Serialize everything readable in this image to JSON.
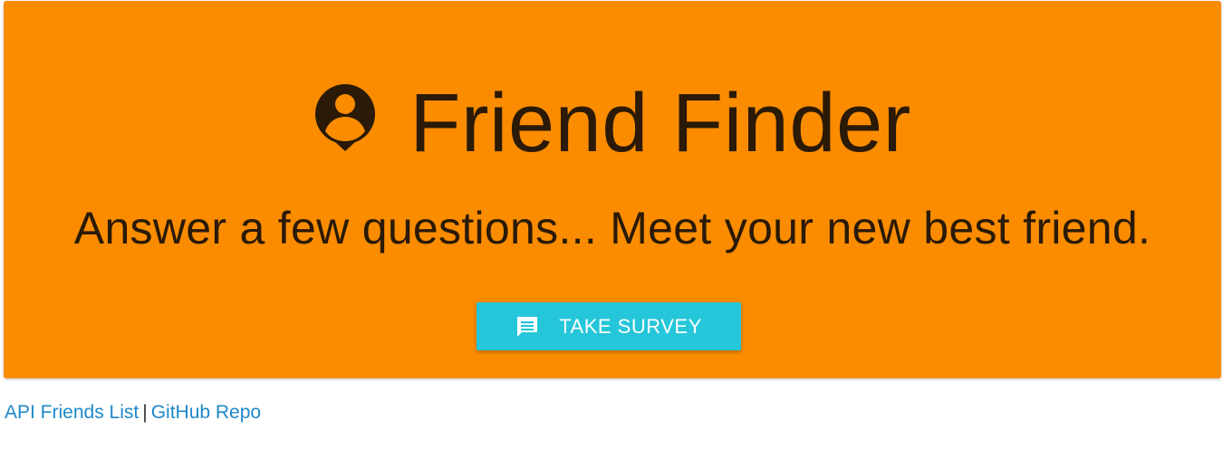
{
  "hero": {
    "title": "Friend Finder",
    "title_icon": "person-pin-icon",
    "tagline": "Answer a few questions... Meet your new best friend.",
    "background_color": "#fb8c00",
    "text_color": "#2a1a07"
  },
  "survey_button": {
    "label": "TAKE SURVEY",
    "icon": "comment-icon",
    "color": "#26c6da"
  },
  "footer": {
    "api_link": "API Friends List",
    "separator": "|",
    "github_link": "GitHub Repo",
    "link_color": "#1e88c8"
  }
}
